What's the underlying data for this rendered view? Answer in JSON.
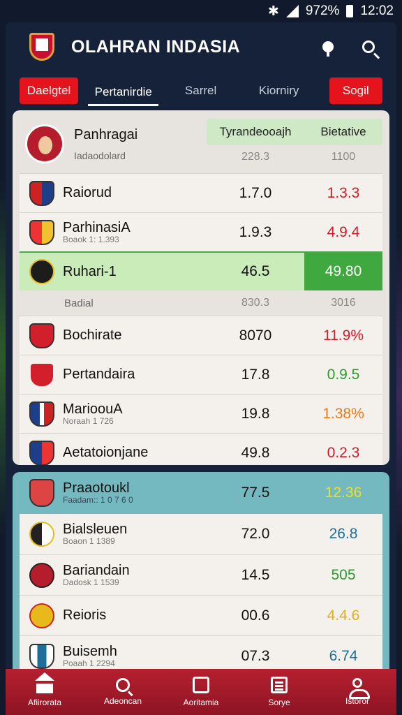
{
  "status": {
    "battery": "972%",
    "time": "12:02"
  },
  "header": {
    "title": "OLAHRAN INDASIA"
  },
  "tabs": [
    {
      "label": "Daelgtel",
      "style": "red"
    },
    {
      "label": "Pertanirdie",
      "style": "active"
    },
    {
      "label": "Sarrel",
      "style": "plain"
    },
    {
      "label": "Kiorniry",
      "style": "plain"
    },
    {
      "label": "Sogil",
      "style": "red"
    }
  ],
  "panel1": {
    "head": {
      "name": "Panhragai",
      "sub": "Iadaodolard",
      "col1": "Tyrandeooajh",
      "col2": "Bietative",
      "val1": "228.3",
      "val2": "1100"
    },
    "rows": [
      {
        "name": "Raiorud",
        "sub": "",
        "n1": "1.7.0",
        "n2": "1.3.3",
        "n2_color": "red"
      },
      {
        "name": "ParhinasiA",
        "sub": "Boaok 1: 1.393",
        "n1": "1.9.3",
        "n2": "4.9.4",
        "n2_color": "red"
      },
      {
        "name": "Ruhari-1",
        "sub": "",
        "n1": "46.5",
        "n2": "49.80",
        "highlight": true
      }
    ],
    "subrow": {
      "label": "Badial",
      "v1": "830.3",
      "v2": "3016"
    },
    "rows2": [
      {
        "name": "Bochirate",
        "sub": "",
        "n1": "8070",
        "n2": "11.9%",
        "n2_color": "red"
      },
      {
        "name": "Pertandaira",
        "sub": "",
        "n1": "17.8",
        "n2": "0.9.5",
        "n2_color": "green"
      },
      {
        "name": "MarioouA",
        "sub": "Noraah 1 726",
        "n1": "19.8",
        "n2": "1.38%",
        "n2_color": "orange"
      },
      {
        "name": "Aetatoionjane",
        "sub": "",
        "n1": "49.8",
        "n1_color": "green",
        "n2": "0.2.3",
        "n2_color": "red"
      }
    ]
  },
  "panel2": {
    "head": {
      "name": "Praaotoukl",
      "sub": "Faadam:: 1 0 7 6 0",
      "n1": "77.5",
      "n2": "12.36"
    },
    "rows": [
      {
        "name": "Bialsleuen",
        "sub": "Boaon 1 1389",
        "n1": "72.0",
        "n2": "26.8",
        "n2_color": "teal"
      },
      {
        "name": "Bariandain",
        "sub": "Dadosk 1 1539",
        "n1": "14.5",
        "n2": "505",
        "n2_color": "green"
      },
      {
        "name": "Reioris",
        "sub": "",
        "n1": "00.6",
        "n1_color": "red",
        "n2": "4.4.6",
        "n2_color": "yellow"
      },
      {
        "name": "Buisemh",
        "sub": "Poaah 1 2294",
        "n1": "07.3",
        "n1_color": "teal",
        "n2": "6.74",
        "n2_color": "teal"
      }
    ]
  },
  "nav": [
    {
      "label": "Afiirorata",
      "icon": "home-icon"
    },
    {
      "label": "Adeoncan",
      "icon": "search-icon"
    },
    {
      "label": "Aoritamia",
      "icon": "pin-icon"
    },
    {
      "label": "Sorye",
      "icon": "list-icon"
    },
    {
      "label": "Istoror",
      "icon": "user-icon"
    }
  ],
  "colors": {
    "red": "#d4192a",
    "green": "#2c9a2c",
    "orange": "#f07a10",
    "teal": "#1d6e9a",
    "yellow": "#e8e22a",
    "accent": "#e4131c"
  }
}
